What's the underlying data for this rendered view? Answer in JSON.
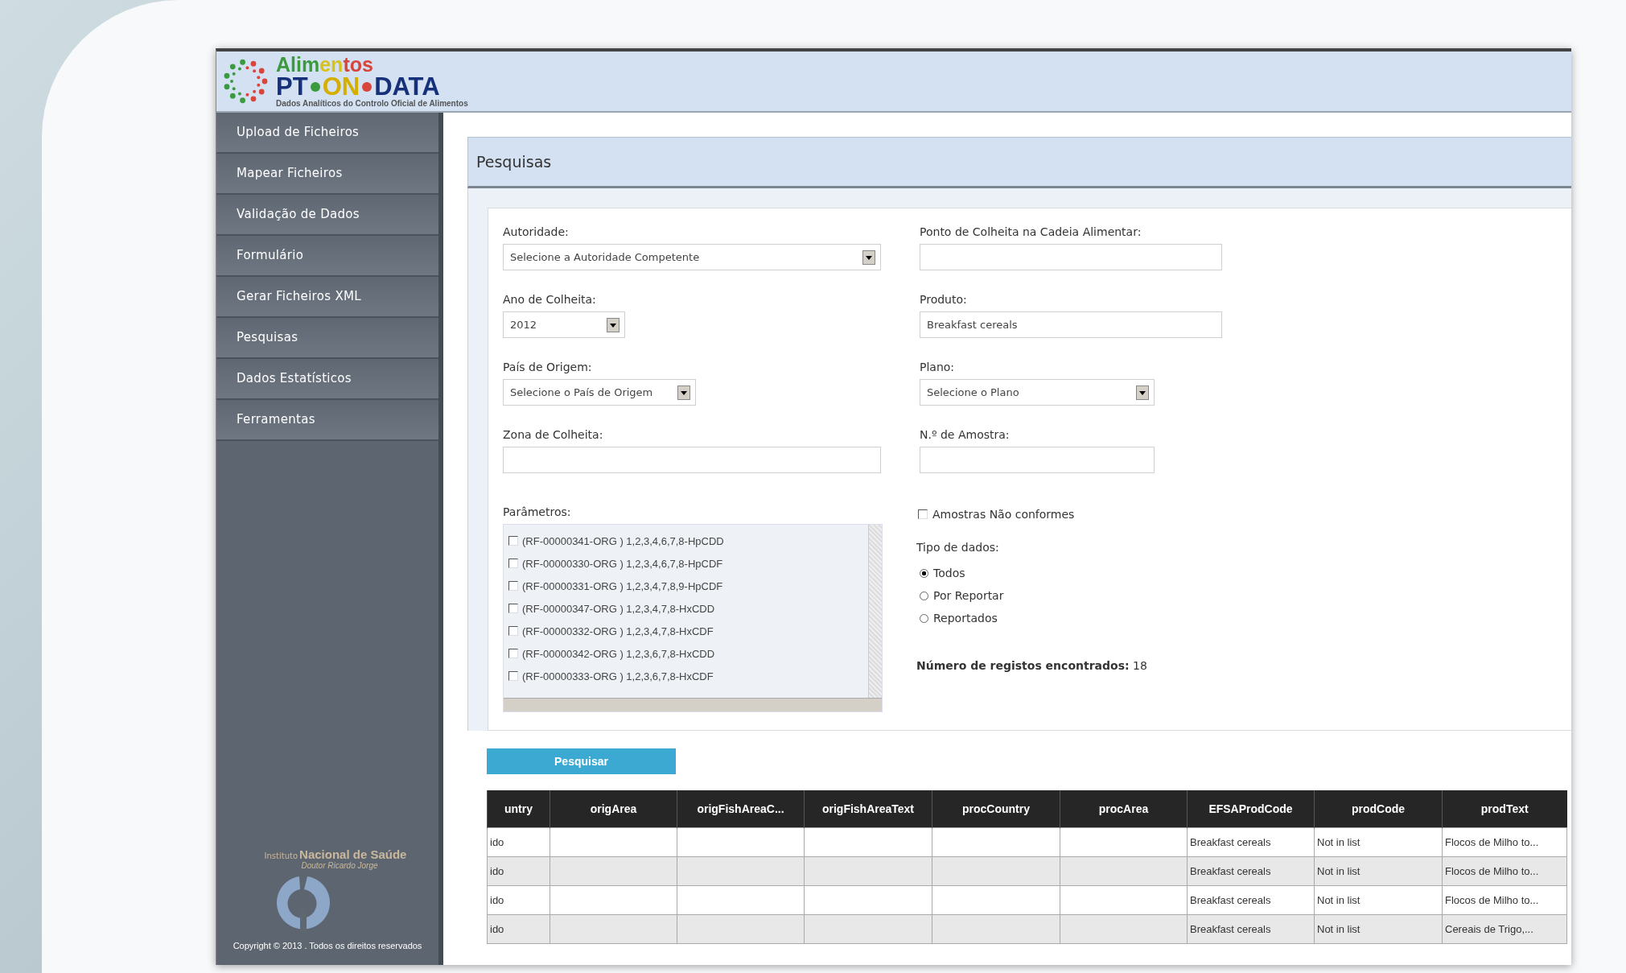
{
  "logo": {
    "title_parts": [
      {
        "text": "Alim",
        "color": "#3b9a3e"
      },
      {
        "text": "en",
        "color": "#d8c21a"
      },
      {
        "text": "tos",
        "color": "#d9453b"
      }
    ],
    "brand_parts": [
      {
        "text": "PT",
        "color": "#16307a"
      },
      {
        "text": "ON",
        "color": "#d4ae00"
      },
      {
        "text": "DATA",
        "color": "#16307a"
      }
    ],
    "subtitle": "Dados Analíticos do Controlo Oficial de Alimentos"
  },
  "sidebar": {
    "items": [
      {
        "label": "Upload de Ficheiros"
      },
      {
        "label": "Mapear Ficheiros"
      },
      {
        "label": "Validação de Dados"
      },
      {
        "label": "Formulário"
      },
      {
        "label": "Gerar Ficheiros XML"
      },
      {
        "label": "Pesquisas"
      },
      {
        "label": "Dados Estatísticos"
      },
      {
        "label": "Ferramentas"
      }
    ],
    "institute": {
      "prefix": "Instituto",
      "name": "Nacional de Saúde",
      "sub": "Doutor Ricardo Jorge"
    },
    "copyright": "Copyright © 2013 . Todos os direitos reservados"
  },
  "panel": {
    "title": "Pesquisas"
  },
  "form": {
    "autoridade": {
      "label": "Autoridade:",
      "value": "Selecione a Autoridade Competente"
    },
    "ano": {
      "label": "Ano de Colheita:",
      "value": "2012"
    },
    "pais": {
      "label": "País de Origem:",
      "value": "Selecione o País de Origem"
    },
    "zona": {
      "label": "Zona de Colheita:"
    },
    "parametros": {
      "label": "Parâmetros:",
      "items": [
        {
          "label": "(RF-00000341-ORG ) 1,2,3,4,6,7,8-HpCDD",
          "checked": false
        },
        {
          "label": "(RF-00000330-ORG ) 1,2,3,4,6,7,8-HpCDF",
          "checked": false
        },
        {
          "label": "(RF-00000331-ORG ) 1,2,3,4,7,8,9-HpCDF",
          "checked": false
        },
        {
          "label": "(RF-00000347-ORG ) 1,2,3,4,7,8-HxCDD",
          "checked": false
        },
        {
          "label": "(RF-00000332-ORG ) 1,2,3,4,7,8-HxCDF",
          "checked": false
        },
        {
          "label": "(RF-00000342-ORG ) 1,2,3,6,7,8-HxCDD",
          "checked": false
        },
        {
          "label": "(RF-00000333-ORG ) 1,2,3,6,7,8-HxCDF",
          "checked": false
        }
      ]
    },
    "ponto": {
      "label": "Ponto de Colheita na Cadeia Alimentar:"
    },
    "produto": {
      "label": "Produto:",
      "value": "Breakfast cereals"
    },
    "plano": {
      "label": "Plano:",
      "value": "Selecione o Plano"
    },
    "amostra": {
      "label": "N.º de Amostra:"
    },
    "nao_conformes": {
      "label": "Amostras Não conformes",
      "checked": false
    },
    "tipo": {
      "label": "Tipo de dados:",
      "options": [
        {
          "label": "Todos",
          "selected": true
        },
        {
          "label": "Por Reportar",
          "selected": false
        },
        {
          "label": "Reportados",
          "selected": false
        }
      ]
    },
    "count": "**Número de registos encontrados:** 18"
  },
  "search_button": "Pesquisar",
  "table": {
    "columns": [
      "untry",
      "origArea",
      "origFishAreaC...",
      "origFishAreaText",
      "procCountry",
      "procArea",
      "EFSAProdCode",
      "prodCode",
      "prodText"
    ],
    "rows": [
      [
        "ido",
        "",
        "",
        "",
        "",
        "",
        "Breakfast cereals",
        "Not in list",
        "Flocos de Milho to..."
      ],
      [
        "ido",
        "",
        "",
        "",
        "",
        "",
        "Breakfast cereals",
        "Not in list",
        "Flocos de Milho to..."
      ],
      [
        "ido",
        "",
        "",
        "",
        "",
        "",
        "Breakfast cereals",
        "Not in list",
        "Flocos de Milho to..."
      ],
      [
        "ido",
        "",
        "",
        "",
        "",
        "",
        "Breakfast cereals",
        "Not in list",
        "Cereais de Trigo,..."
      ]
    ]
  }
}
